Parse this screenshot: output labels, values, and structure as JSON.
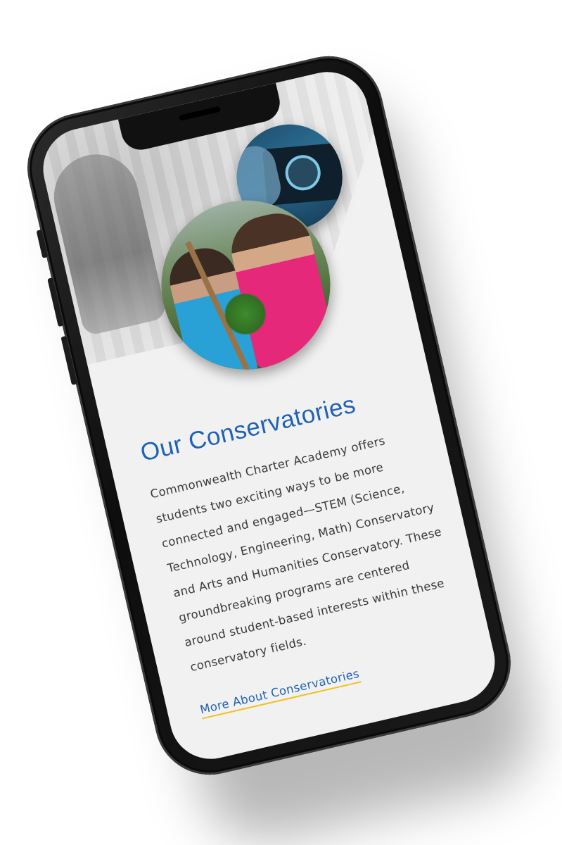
{
  "page": {
    "heading": "Our Conservatories",
    "body": "Commonwealth Charter Academy offers students two exciting ways to be more connected and engaged—STEM (Science, Technology, Engineering, Math) Conservatory and Arts and Humanities Conservatory. These groundbreaking programs are centered around student-based interests within these conservatory fields.",
    "cta_label": "More About Conservatories"
  },
  "colors": {
    "heading": "#1f62b5",
    "link": "#1f62b5",
    "link_underline": "#f1c21b",
    "screen_background": "#f2f1f2",
    "phone_frame": "#111111"
  },
  "images": {
    "hero_background": "grayscale-classroom-photo",
    "circle_small": "student-dj-controller-photo",
    "circle_large": "students-gardening-photo"
  }
}
